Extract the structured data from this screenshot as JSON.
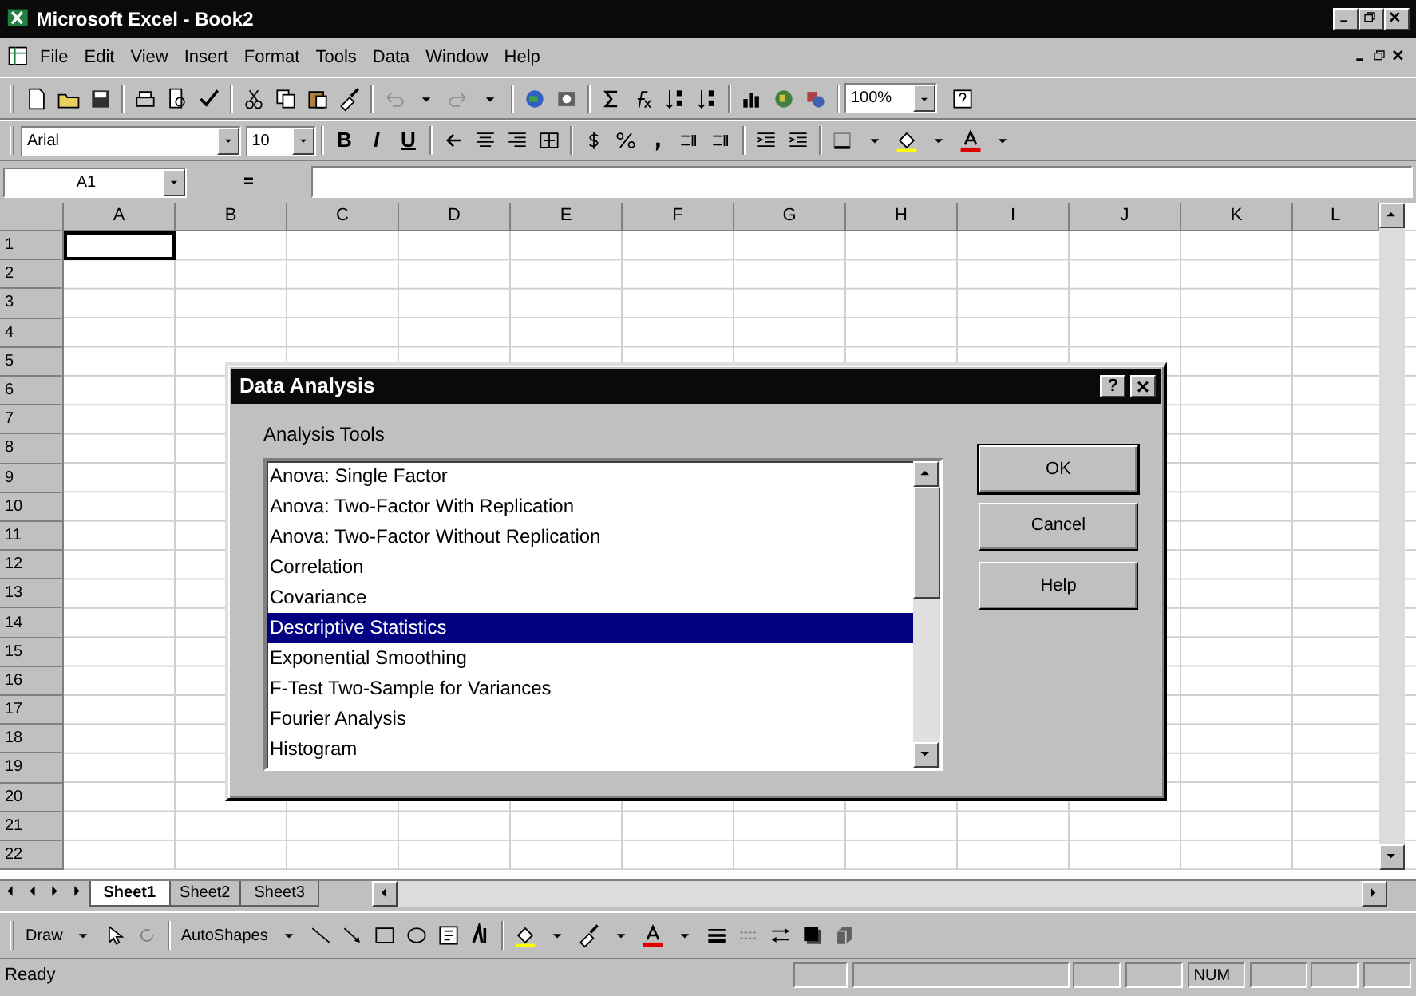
{
  "window": {
    "title": "Microsoft Excel - Book2"
  },
  "menu": [
    "File",
    "Edit",
    "View",
    "Insert",
    "Format",
    "Tools",
    "Data",
    "Window",
    "Help"
  ],
  "standard_toolbar": {
    "zoom": "100%"
  },
  "formatting_toolbar": {
    "font": "Arial",
    "size": "10",
    "bold": "B",
    "italic": "I",
    "underline": "U"
  },
  "formula_bar": {
    "name_box": "A1",
    "equals": "="
  },
  "sheet": {
    "columns": [
      "A",
      "B",
      "C",
      "D",
      "E",
      "F",
      "G",
      "H",
      "I",
      "J",
      "K",
      "L"
    ],
    "rows": [
      "1",
      "2",
      "3",
      "4",
      "5",
      "6",
      "7",
      "8",
      "9",
      "10",
      "11",
      "12",
      "13",
      "14",
      "15",
      "16",
      "17",
      "18",
      "19",
      "20",
      "21",
      "22"
    ]
  },
  "sheet_tabs": [
    {
      "label": "Sheet1",
      "selected": true
    },
    {
      "label": "Sheet2",
      "selected": false
    },
    {
      "label": "Sheet3",
      "selected": false
    }
  ],
  "dialog": {
    "title": "Data Analysis",
    "label": "Analysis Tools",
    "items": [
      {
        "label": "Anova: Single Factor",
        "selected": false
      },
      {
        "label": "Anova: Two-Factor With Replication",
        "selected": false
      },
      {
        "label": "Anova: Two-Factor Without Replication",
        "selected": false
      },
      {
        "label": "Correlation",
        "selected": false
      },
      {
        "label": "Covariance",
        "selected": false
      },
      {
        "label": "Descriptive Statistics",
        "selected": true
      },
      {
        "label": "Exponential Smoothing",
        "selected": false
      },
      {
        "label": "F-Test Two-Sample for Variances",
        "selected": false
      },
      {
        "label": "Fourier Analysis",
        "selected": false
      },
      {
        "label": "Histogram",
        "selected": false
      }
    ],
    "buttons": [
      "OK",
      "Cancel",
      "Help"
    ],
    "help_glyph": "?",
    "close_glyph": "×"
  },
  "drawing_toolbar": {
    "draw": "Draw",
    "autoshapes": "AutoShapes"
  },
  "status_bar": {
    "text": "Ready",
    "num": "NUM"
  }
}
